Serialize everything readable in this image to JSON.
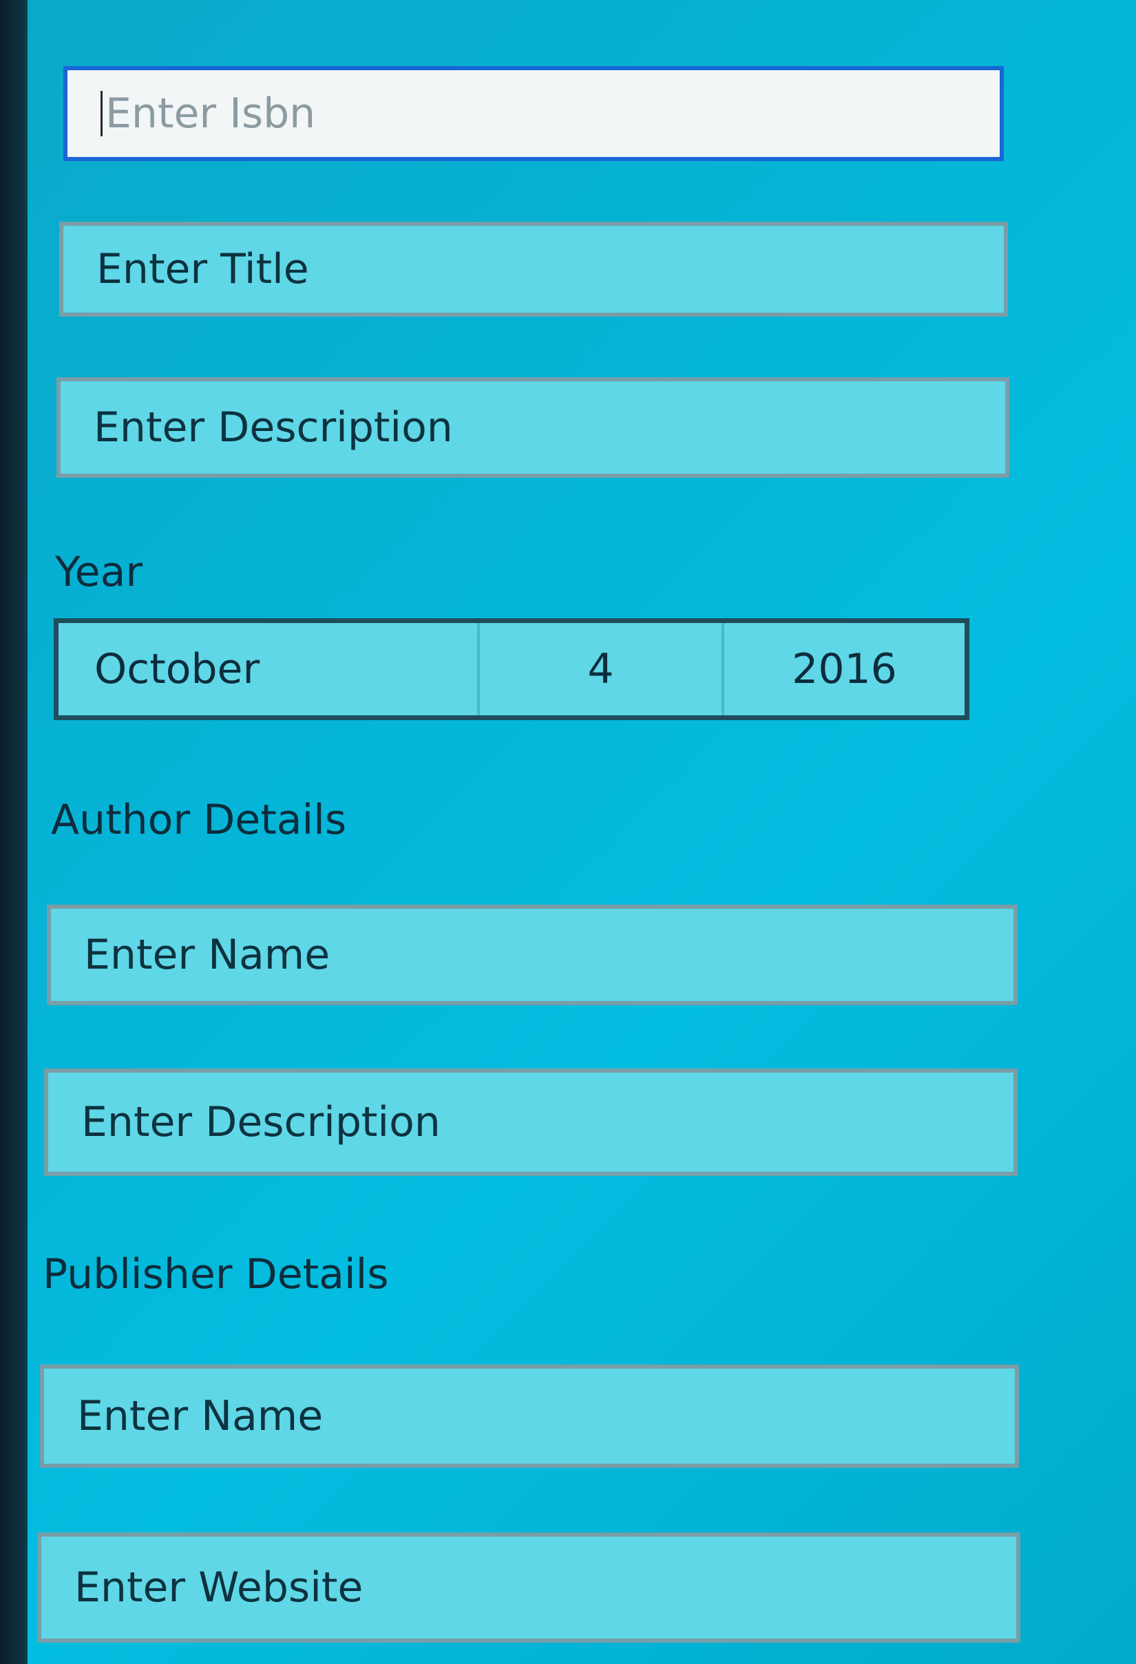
{
  "form": {
    "isbn_placeholder": "Enter Isbn",
    "title_placeholder": "Enter Title",
    "description_placeholder": "Enter Description",
    "year_label": "Year",
    "date": {
      "month": "October",
      "day": "4",
      "year": "2016"
    },
    "author": {
      "section_label": "Author Details",
      "name_placeholder": "Enter Name",
      "description_placeholder": "Enter Description"
    },
    "publisher": {
      "section_label": "Publisher Details",
      "name_placeholder": "Enter Name",
      "website_placeholder": "Enter Website"
    }
  },
  "colors": {
    "panel": "#05b4d6",
    "field_fill": "#5fd7e6",
    "field_border": "#7a9ea8",
    "focus_border": "#1767d6",
    "text": "#0d2c3c"
  }
}
